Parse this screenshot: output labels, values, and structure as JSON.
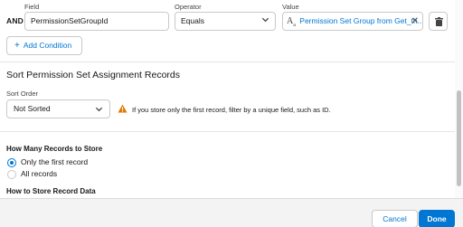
{
  "condition": {
    "and_label": "AND",
    "field_label": "Field",
    "field_value": "PermissionSetGroupId",
    "operator_label": "Operator",
    "operator_value": "Equals",
    "value_label": "Value",
    "value_value": "Permission Set Group from Get_th..."
  },
  "add_condition_label": "Add Condition",
  "sort_section": {
    "title": "Sort Permission Set Assignment Records",
    "sort_order_label": "Sort Order",
    "sort_order_value": "Not Sorted",
    "warning_text": "If you store only the first record, filter by a unique field, such as ID."
  },
  "records_store": {
    "title": "How Many Records to Store",
    "options": [
      "Only the first record",
      "All records"
    ],
    "selected": "Only the first record"
  },
  "how_to_store_title": "How to Store Record Data",
  "footer": {
    "cancel_label": "Cancel",
    "done_label": "Done"
  },
  "colors": {
    "brand": "#0176d3",
    "warning": "#dd7a01",
    "footer_bg": "#f3f3f3"
  },
  "icons": {
    "value_type": "text-resource-icon",
    "clear": "close-icon",
    "delete": "trash-icon",
    "add": "plus-icon",
    "warning": "warning-icon",
    "dropdown": "chevron-down-icon"
  }
}
